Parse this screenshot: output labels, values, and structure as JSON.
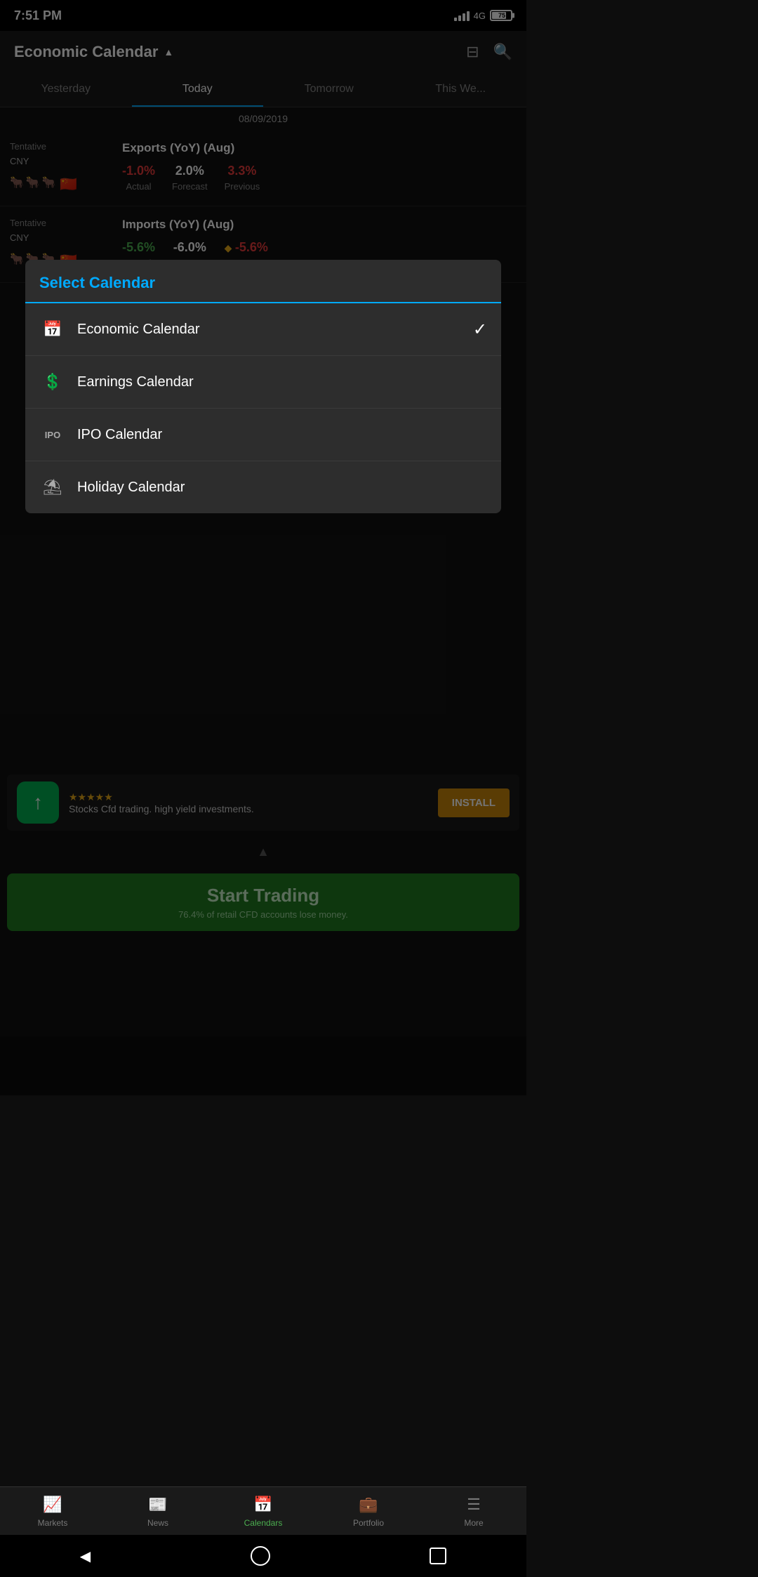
{
  "statusBar": {
    "time": "7:51 PM",
    "network": "4G",
    "battery": "75"
  },
  "header": {
    "title": "Economic Calendar",
    "dropdownArrow": "▲",
    "filterIcon": "⊟",
    "searchIcon": "🔍"
  },
  "tabs": [
    {
      "label": "Yesterday",
      "active": false
    },
    {
      "label": "Today",
      "active": true
    },
    {
      "label": "Tomorrow",
      "active": false
    },
    {
      "label": "This We...",
      "active": false
    }
  ],
  "dateHeader": "08/09/2019",
  "events": [
    {
      "label": "Tentative",
      "currency": "CNY",
      "name": "Exports (YoY) (Aug)",
      "actual": "-1.0%",
      "actualColor": "negative",
      "forecast": "2.0%",
      "forecastColor": "neutral",
      "previous": "3.3%",
      "previousColor": "red",
      "hasDiamond": false
    },
    {
      "label": "Tentative",
      "currency": "CNY",
      "name": "Imports (YoY) (Aug)",
      "actual": "-5.6%",
      "actualColor": "positive",
      "forecast": "-6.0%",
      "forecastColor": "neutral",
      "previous": "-5.6%",
      "previousColor": "red",
      "hasDiamond": true
    }
  ],
  "selectCalendar": {
    "title": "Select Calendar",
    "items": [
      {
        "label": "Economic Calendar",
        "icon": "📅",
        "selected": true
      },
      {
        "label": "Earnings Calendar",
        "icon": "💲",
        "selected": false
      },
      {
        "label": "IPO Calendar",
        "icon": "IPO",
        "selected": false
      },
      {
        "label": "Holiday Calendar",
        "icon": "⛱",
        "selected": false
      }
    ]
  },
  "adBanner": {
    "iconLabel": "↑",
    "stars": "★★★★★",
    "text": "Stocks Cfd trading. high yield investments.",
    "installLabel": "INSTALL"
  },
  "startTrading": {
    "title": "Start Trading",
    "subtitle": "76.4% of retail CFD accounts lose money."
  },
  "bottomNav": {
    "items": [
      {
        "label": "Markets",
        "icon": "📈",
        "active": false
      },
      {
        "label": "News",
        "icon": "📰",
        "active": false
      },
      {
        "label": "Calendars",
        "icon": "📅",
        "active": true
      },
      {
        "label": "Portfolio",
        "icon": "💼",
        "active": false
      },
      {
        "label": "More",
        "icon": "☰",
        "active": false
      }
    ]
  }
}
